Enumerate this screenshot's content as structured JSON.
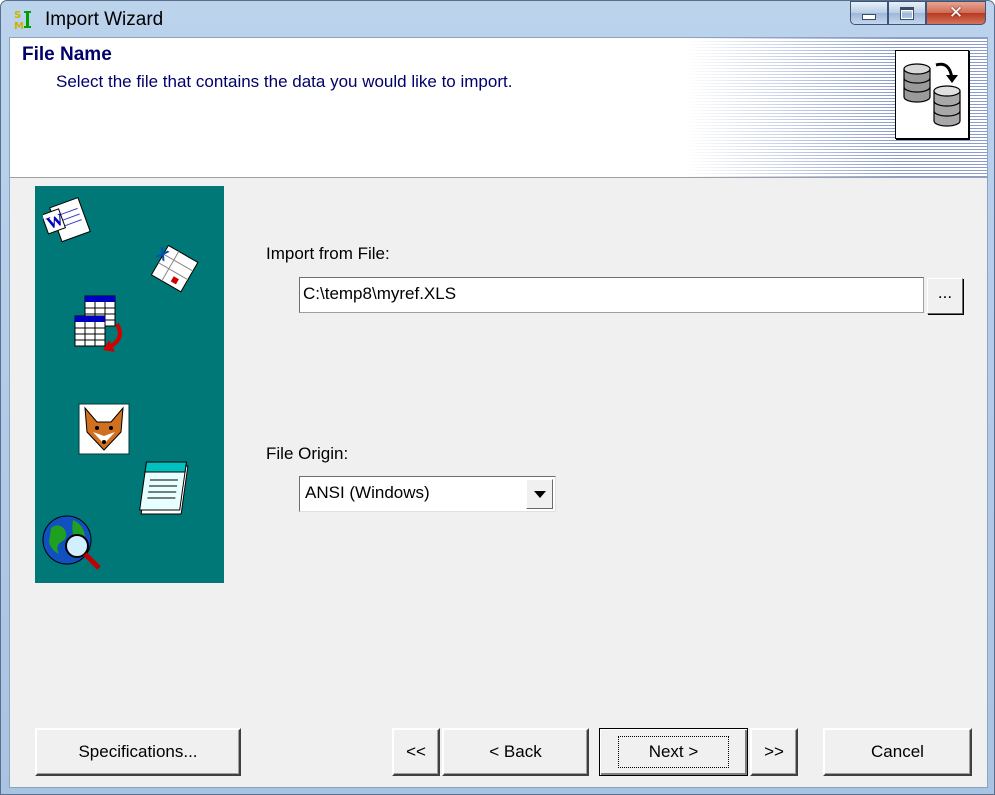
{
  "window": {
    "title": "Import Wizard"
  },
  "header": {
    "title": "File Name",
    "subtitle": "Select the file that contains the data you would like to import."
  },
  "form": {
    "import_label": "Import from File:",
    "import_value": "C:\\temp8\\myref.XLS",
    "browse_label": "...",
    "origin_label": "File Origin:",
    "origin_value": "ANSI (Windows)"
  },
  "buttons": {
    "specifications": "Specifications...",
    "first": "<<",
    "back": "< Back",
    "next": "Next >",
    "last": ">>",
    "cancel": "Cancel"
  },
  "icons": [
    "app-icon",
    "minimize-icon",
    "maximize-icon",
    "close-icon",
    "database-convert-icon",
    "word-doc-icon",
    "excel-doc-icon",
    "table-convert-icon",
    "foxpro-icon",
    "notepad-icon",
    "globe-search-icon",
    "dropdown-arrow-icon"
  ],
  "colors": {
    "side_panel": "#007878",
    "header_text": "#00006a",
    "dialog_bg": "#f0f0f0"
  }
}
